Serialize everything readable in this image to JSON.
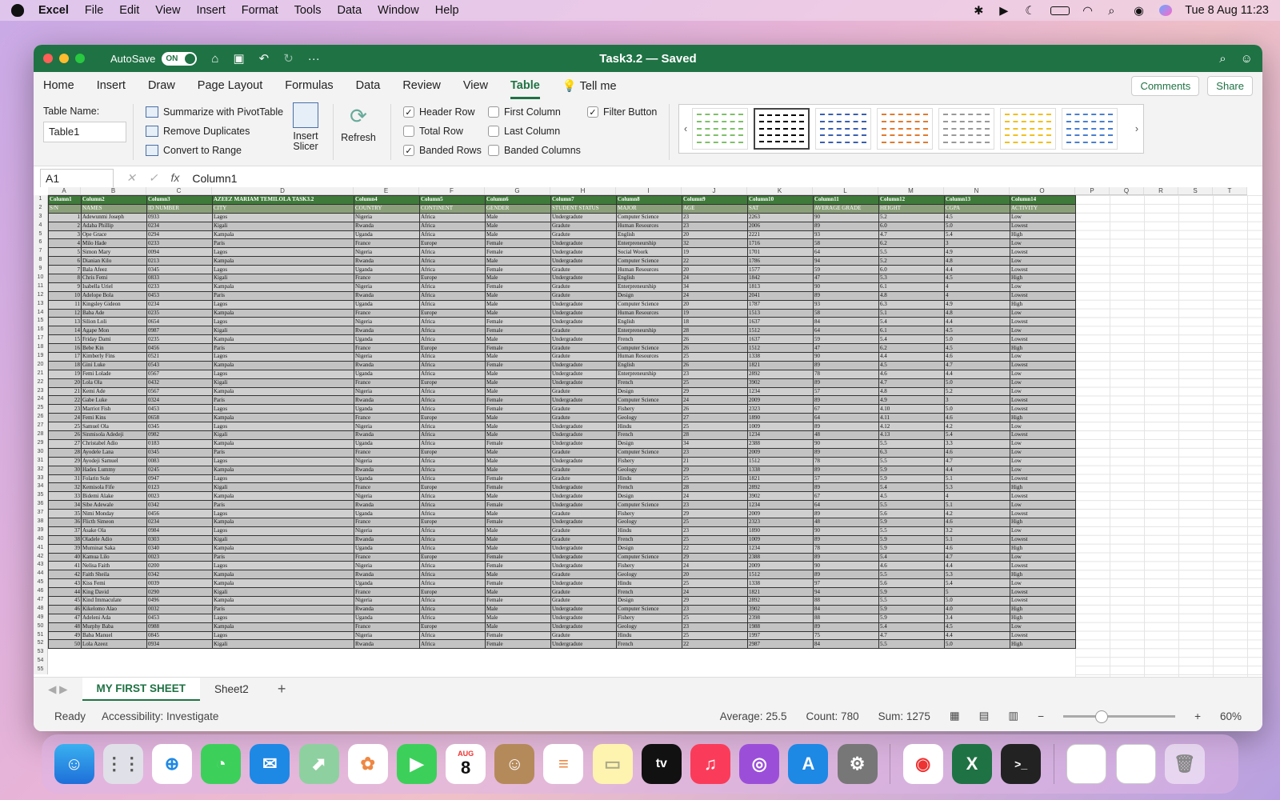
{
  "menubar": {
    "app": "Excel",
    "items": [
      "File",
      "Edit",
      "View",
      "Insert",
      "Format",
      "Tools",
      "Data",
      "Window",
      "Help"
    ],
    "datetime": "Tue 8 Aug  11:23"
  },
  "titlebar": {
    "autosave": "AutoSave",
    "toggle": "ON",
    "doc": "Task3.2 — Saved"
  },
  "tabs": [
    "Home",
    "Insert",
    "Draw",
    "Page Layout",
    "Formulas",
    "Data",
    "Review",
    "View",
    "Table",
    "Tell me"
  ],
  "active_tab": "Table",
  "buttons": {
    "comments": "Comments",
    "share": "Share"
  },
  "ribbon": {
    "table_name_label": "Table Name:",
    "table_name": "Table1",
    "summarize": "Summarize with PivotTable",
    "remove_dup": "Remove Duplicates",
    "convert": "Convert to Range",
    "insert_slicer": "Insert Slicer",
    "refresh": "Refresh",
    "options": [
      {
        "label": "Header Row",
        "checked": true
      },
      {
        "label": "Total Row",
        "checked": false
      },
      {
        "label": "Banded Rows",
        "checked": true
      },
      {
        "label": "First Column",
        "checked": false
      },
      {
        "label": "Last Column",
        "checked": false
      },
      {
        "label": "Banded Columns",
        "checked": false
      },
      {
        "label": "Filter Button",
        "checked": true
      }
    ],
    "style_colors": [
      "#7fbf6a",
      "#000000",
      "#3a5fb0",
      "#e07b30",
      "#999999",
      "#f0c020",
      "#4a7fd0"
    ]
  },
  "formula": {
    "cell": "A1",
    "value": "Column1"
  },
  "columns": [
    "A",
    "B",
    "C",
    "D",
    "E",
    "F",
    "G",
    "H",
    "I",
    "J",
    "K",
    "L",
    "M",
    "N",
    "O",
    "P",
    "Q",
    "R",
    "S",
    "T"
  ],
  "table": {
    "header1": [
      "Column1",
      "Column2",
      "Column3",
      "AZEEZ MARIAM TEMILOLA TASK3.2",
      "Column4",
      "Column5",
      "Column6",
      "Column7",
      "Column8",
      "Column9",
      "Column10",
      "Column11",
      "Column12",
      "Column13",
      "Column14"
    ],
    "header2": [
      "S/N",
      "NAMES",
      "ID NUMBER",
      "CITY",
      "COUNTRY",
      "CONTINENT",
      "GENDER",
      "STUDENT STATUS",
      "MAJOR",
      "AGE",
      "SAT",
      "AVERAGE GRADE",
      "HEIGHT",
      "CGPA",
      "ACTIVITY"
    ],
    "rows": [
      [
        "1",
        "Adewunmi Joseph",
        "0933",
        "Lagos",
        "Nigeria",
        "Africa",
        "Male",
        "Undergradute",
        "Computer Science",
        "23",
        "2263",
        "90",
        "5.2",
        "4.5",
        "Low"
      ],
      [
        "2",
        "Adaba Phillip",
        "0234",
        "Kigali",
        "Rwanda",
        "Africa",
        "Male",
        "Gradute",
        "Human Resources",
        "23",
        "2006",
        "89",
        "6.0",
        "5.0",
        "Lowest"
      ],
      [
        "3",
        "Ope Grace",
        "0294",
        "Kampala",
        "Uganda",
        "Africa",
        "Male",
        "Gradute",
        "English",
        "20",
        "2221",
        "93",
        "4.7",
        "5.4",
        "High"
      ],
      [
        "4",
        "Milo Hade",
        "0233",
        "Paris",
        "France",
        "Europe",
        "Female",
        "Undergradute",
        "Enterpreneurship",
        "32",
        "1716",
        "58",
        "6.2",
        "3",
        "Low"
      ],
      [
        "5",
        "Simon Mary",
        "0094",
        "Lagos",
        "Nigeria",
        "Africa",
        "Female",
        "Undergradute",
        "Social Woork",
        "19",
        "1701",
        "64",
        "5.5",
        "4.9",
        "Lowest"
      ],
      [
        "6",
        "Dianian Kilo",
        "0213",
        "Kampala",
        "Rwanda",
        "Africa",
        "Male",
        "Undergradute",
        "Computer Science",
        "22",
        "1786",
        "94",
        "5.2",
        "4.8",
        "Low"
      ],
      [
        "7",
        "Bala Afeez",
        "0345",
        "Lagos",
        "Uganda",
        "Africa",
        "Female",
        "Gradute",
        "Human Resources",
        "20",
        "1577",
        "59",
        "6.0",
        "4.4",
        "Lowest"
      ],
      [
        "8",
        "Chris Femi",
        "0833",
        "Kigali",
        "France",
        "Europe",
        "Male",
        "Undergradute",
        "English",
        "24",
        "1842",
        "47",
        "5.3",
        "4.5",
        "High"
      ],
      [
        "9",
        "Isabella Uriel",
        "0233",
        "Kampala",
        "Nigeria",
        "Africa",
        "Female",
        "Gradute",
        "Enterpreneurship",
        "34",
        "1813",
        "90",
        "6.1",
        "4",
        "Low"
      ],
      [
        "10",
        "Adelope Bola",
        "0453",
        "Paris",
        "Rwanda",
        "Africa",
        "Male",
        "Gradute",
        "Design",
        "24",
        "2041",
        "89",
        "4.8",
        "4",
        "Lowest"
      ],
      [
        "11",
        "Kingsley Gideon",
        "0234",
        "Lagos",
        "Uganda",
        "Africa",
        "Male",
        "Undergradute",
        "Computer Science",
        "20",
        "1787",
        "93",
        "6.3",
        "4.9",
        "High"
      ],
      [
        "12",
        "Baba Ade",
        "0235",
        "Kampala",
        "France",
        "Europe",
        "Male",
        "Undergradute",
        "Human Resources",
        "19",
        "1513",
        "58",
        "5.1",
        "4.8",
        "Low"
      ],
      [
        "13",
        "Silion Loli",
        "0654",
        "Lagos",
        "Nigeria",
        "Africa",
        "Female",
        "Undergradute",
        "English",
        "18",
        "1637",
        "84",
        "5.4",
        "4.4",
        "Lowest"
      ],
      [
        "14",
        "Agape Mon",
        "0987",
        "Kigali",
        "Rwanda",
        "Africa",
        "Female",
        "Gradute",
        "Enterpreneurship",
        "28",
        "1512",
        "64",
        "6.1",
        "4.5",
        "Low"
      ],
      [
        "15",
        "Friday Dami",
        "0235",
        "Kampala",
        "Uganda",
        "Africa",
        "Male",
        "Undergradute",
        "French",
        "26",
        "1637",
        "59",
        "5.4",
        "5.0",
        "Lowest"
      ],
      [
        "16",
        "Bebe Kin",
        "0456",
        "Paris",
        "France",
        "Europe",
        "Female",
        "Gradute",
        "Computer Science",
        "26",
        "1512",
        "47",
        "6.2",
        "4.5",
        "High"
      ],
      [
        "17",
        "Kimberly Fins",
        "0521",
        "Lagos",
        "Nigeria",
        "Africa",
        "Male",
        "Gradute",
        "Human Resources",
        "25",
        "1338",
        "90",
        "4.4",
        "4.6",
        "Low"
      ],
      [
        "18",
        "Gini Luke",
        "0543",
        "Kampala",
        "Rwanda",
        "Africa",
        "Female",
        "Undergradute",
        "English",
        "26",
        "1821",
        "89",
        "4.5",
        "4.7",
        "Lowest"
      ],
      [
        "19",
        "Femi Lolade",
        "0567",
        "Lagos",
        "Uganda",
        "Africa",
        "Male",
        "Undergradute",
        "Enterpreneurship",
        "23",
        "2892",
        "78",
        "4.6",
        "4.4",
        "Low"
      ],
      [
        "20",
        "Lola Ola",
        "0432",
        "Kigali",
        "France",
        "Europe",
        "Male",
        "Undergradute",
        "French",
        "25",
        "3902",
        "89",
        "4.7",
        "5.0",
        "Low"
      ],
      [
        "21",
        "Kemi Ade",
        "0567",
        "Kampala",
        "Nigeria",
        "Africa",
        "Male",
        "Gradute",
        "Design",
        "29",
        "1234",
        "57",
        "4.8",
        "5.2",
        "Low"
      ],
      [
        "22",
        "Gabe Luke",
        "0324",
        "Paris",
        "Rwanda",
        "Africa",
        "Female",
        "Undergradute",
        "Computer Science",
        "24",
        "2009",
        "89",
        "4.9",
        "3",
        "Lowest"
      ],
      [
        "23",
        "Marriot Fish",
        "0453",
        "Lagos",
        "Uganda",
        "Africa",
        "Female",
        "Gradute",
        "Fishery",
        "26",
        "2323",
        "67",
        "4.10",
        "5.0",
        "Lowest"
      ],
      [
        "24",
        "Femi Kins",
        "0658",
        "Kampala",
        "France",
        "Europe",
        "Male",
        "Gradute",
        "Geology",
        "27",
        "1890",
        "64",
        "4.11",
        "4.6",
        "High"
      ],
      [
        "25",
        "Samuel Ola",
        "0345",
        "Lagos",
        "Nigeria",
        "Africa",
        "Male",
        "Undergradute",
        "Hindu",
        "25",
        "1009",
        "89",
        "4.12",
        "4.2",
        "Low"
      ],
      [
        "26",
        "Sinmisola Adedeji",
        "0982",
        "Kigali",
        "Rwanda",
        "Africa",
        "Male",
        "Undergradute",
        "French",
        "28",
        "1234",
        "48",
        "4.13",
        "5.4",
        "Lowest"
      ],
      [
        "27",
        "Christabel Adio",
        "0183",
        "Kampala",
        "Uganda",
        "Africa",
        "Female",
        "Undergradute",
        "Design",
        "34",
        "2388",
        "90",
        "5.5",
        "3.3",
        "Low"
      ],
      [
        "28",
        "Ayodele Lana",
        "0345",
        "Paris",
        "France",
        "Europe",
        "Male",
        "Gradute",
        "Computer Science",
        "23",
        "2009",
        "89",
        "6.3",
        "4.6",
        "Low"
      ],
      [
        "29",
        "Ayodeji Samuel",
        "0083",
        "Lagos",
        "Nigeria",
        "Africa",
        "Male",
        "Undergradute",
        "Fishery",
        "21",
        "1512",
        "78",
        "5.5",
        "4.7",
        "Low"
      ],
      [
        "30",
        "Hades Lummy",
        "0245",
        "Kampala",
        "Rwanda",
        "Africa",
        "Male",
        "Gradute",
        "Geology",
        "29",
        "1338",
        "89",
        "5.9",
        "4.4",
        "Low"
      ],
      [
        "31",
        "Folarin Sule",
        "0947",
        "Lagos",
        "Uganda",
        "Africa",
        "Female",
        "Gradute",
        "Hindu",
        "25",
        "1821",
        "57",
        "5.9",
        "5.1",
        "Lowest"
      ],
      [
        "32",
        "Kemisola Fife",
        "0123",
        "Kigali",
        "France",
        "Europe",
        "Female",
        "Undergradute",
        "French",
        "28",
        "2892",
        "89",
        "5.4",
        "5.3",
        "High"
      ],
      [
        "33",
        "Bidemi Alake",
        "0023",
        "Kampala",
        "Nigeria",
        "Africa",
        "Male",
        "Undergradute",
        "Design",
        "24",
        "3902",
        "67",
        "4.5",
        "4",
        "Lowest"
      ],
      [
        "34",
        "Sibe Adewale",
        "0342",
        "Paris",
        "Rwanda",
        "Africa",
        "Female",
        "Undergradute",
        "Computer Science",
        "23",
        "1234",
        "64",
        "5.5",
        "5.1",
        "Low"
      ],
      [
        "35",
        "Nimi Monday",
        "0456",
        "Lagos",
        "Uganda",
        "Africa",
        "Male",
        "Gradute",
        "Fishery",
        "29",
        "2009",
        "89",
        "5.6",
        "4.2",
        "Lowest"
      ],
      [
        "36",
        "Flicth Simeon",
        "0234",
        "Kampala",
        "France",
        "Europe",
        "Female",
        "Undergradute",
        "Geology",
        "25",
        "2323",
        "48",
        "5.9",
        "4.6",
        "High"
      ],
      [
        "37",
        "Asake Ola",
        "0984",
        "Lagos",
        "Nigeria",
        "Africa",
        "Male",
        "Gradute",
        "Hindu",
        "23",
        "1890",
        "90",
        "5.5",
        "3.2",
        "Low"
      ],
      [
        "38",
        "Oladele Adio",
        "0303",
        "Kigali",
        "Rwanda",
        "Africa",
        "Male",
        "Gradute",
        "French",
        "25",
        "1009",
        "89",
        "5.9",
        "5.1",
        "Lowest"
      ],
      [
        "39",
        "Muminat Saka",
        "0340",
        "Kampala",
        "Uganda",
        "Africa",
        "Male",
        "Undergradute",
        "Design",
        "22",
        "1234",
        "78",
        "5.9",
        "4.6",
        "High"
      ],
      [
        "40",
        "Kamua Lilo",
        "0023",
        "Paris",
        "France",
        "Europe",
        "Female",
        "Undergradute",
        "Computer Science",
        "29",
        "2388",
        "89",
        "5.4",
        "4.7",
        "Low"
      ],
      [
        "41",
        "Nelisa Faith",
        "0200",
        "Lagos",
        "Nigeria",
        "Africa",
        "Female",
        "Undergradute",
        "Fishery",
        "24",
        "2009",
        "90",
        "4.6",
        "4.4",
        "Lowest"
      ],
      [
        "42",
        "Faith Sheila",
        "0342",
        "Kampala",
        "Rwanda",
        "Africa",
        "Male",
        "Gradute",
        "Geology",
        "20",
        "1512",
        "89",
        "5.5",
        "5.3",
        "High"
      ],
      [
        "43",
        "Kiss Femi",
        "0039",
        "Kampala",
        "Uganda",
        "Africa",
        "Female",
        "Undergradute",
        "Hindu",
        "25",
        "1338",
        "97",
        "5.6",
        "5.4",
        "Low"
      ],
      [
        "44",
        "King David",
        "0290",
        "Kigali",
        "France",
        "Europe",
        "Male",
        "Gradute",
        "French",
        "24",
        "1821",
        "94",
        "5.9",
        "5",
        "Lowest"
      ],
      [
        "45",
        "Kind Immaculate",
        "0496",
        "Kampala",
        "Nigeria",
        "Africa",
        "Female",
        "Gradute",
        "Design",
        "29",
        "2892",
        "88",
        "5.5",
        "5.0",
        "Lowest"
      ],
      [
        "46",
        "Kikelomo Alao",
        "0032",
        "Paris",
        "Rwanda",
        "Africa",
        "Male",
        "Undergradute",
        "Computer Science",
        "23",
        "3902",
        "84",
        "5.9",
        "4.0",
        "High"
      ],
      [
        "47",
        "Adeleni Ada",
        "0453",
        "Lagos",
        "Uganda",
        "Africa",
        "Male",
        "Undergradute",
        "Fishery",
        "25",
        "2398",
        "88",
        "5.9",
        "3.4",
        "High"
      ],
      [
        "48",
        "Murphy Baba",
        "0988",
        "Kampala",
        "France",
        "Europe",
        "Male",
        "Undergradute",
        "Geology",
        "23",
        "1988",
        "89",
        "5.4",
        "4.5",
        "Low"
      ],
      [
        "49",
        "Baba Manuel",
        "0845",
        "Lagos",
        "Nigeria",
        "Africa",
        "Female",
        "Gradute",
        "Hindu",
        "25",
        "1997",
        "75",
        "4.7",
        "4.4",
        "Lowest"
      ],
      [
        "50",
        "Lola Azeez",
        "0934",
        "Kigali",
        "Rwanda",
        "Africa",
        "Female",
        "Undergradute",
        "French",
        "22",
        "2987",
        "84",
        "5.5",
        "5.0",
        "High"
      ]
    ]
  },
  "sheettabs": [
    "MY FIRST SHEET",
    "Sheet2"
  ],
  "status": {
    "ready": "Ready",
    "accessibility": "Accessibility: Investigate",
    "average": "Average: 25.5",
    "count": "Count: 780",
    "sum": "Sum: 1275",
    "zoom": "60%"
  },
  "dock": {
    "calendar_month": "AUG",
    "calendar_day": "8",
    "tv": "tv"
  }
}
